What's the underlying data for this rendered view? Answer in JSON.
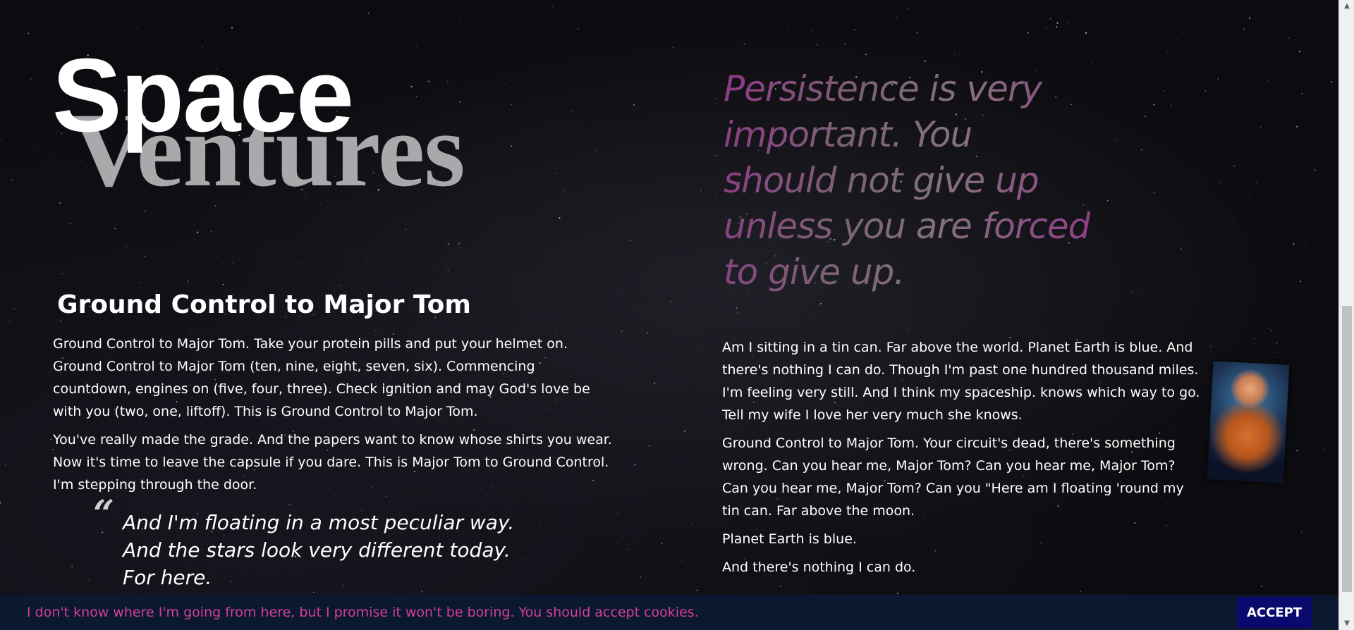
{
  "logo": {
    "word1": "Space",
    "word2": "Ventures"
  },
  "hero_quote": {
    "text": "Persistence is very important. You should not give up unless you are forced to give up."
  },
  "left": {
    "heading": "Ground Control to Major Tom",
    "paragraphs": [
      "Ground Control to Major Tom. Take your protein pills and put your helmet on. Ground Control to Major Tom (ten, nine, eight, seven, six). Commencing countdown, engines on (five, four, three). Check ignition and may God's love be with you (two, one, liftoff). This is Ground Control to Major Tom.",
      "You've really made the grade. And the papers want to know whose shirts you wear. Now it's time to leave the capsule if you dare. This is Major Tom to Ground Control. I'm stepping through the door."
    ],
    "blockquote": {
      "mark": "“",
      "lines": [
        "And I'm floating in a most peculiar way.",
        "And the stars look very different today.",
        "For here."
      ]
    }
  },
  "right": {
    "paragraphs": [
      "Am I sitting in a tin can. Far above the world. Planet Earth is blue. And there's nothing I can do. Though I'm past one hundred thousand miles. I'm feeling very still. And I think my spaceship. knows which way to go. Tell my wife I love her very much she knows.",
      "Ground Control to Major Tom. Your circuit's dead, there's something wrong. Can you hear me, Major Tom? Can you hear me, Major Tom? Can you hear me, Major Tom? Can you \"Here am I floating 'round my tin can. Far above the moon.",
      "Planet Earth is blue.",
      "And there's nothing I can do."
    ]
  },
  "cookie": {
    "message": "I don't know where I'm going from here, but I promise it won't be boring. You should accept cookies.",
    "accept_label": "ACCEPT"
  },
  "icons": {
    "scroll_up": "scroll-up-arrow-icon",
    "scroll_down": "scroll-down-arrow-icon",
    "quote": "quote-mark-icon"
  },
  "colors": {
    "background": "#0c0c10",
    "quote_pink": "#8e3a86",
    "cookie_bar": "#0a1930",
    "cookie_text": "#d63f93",
    "accept_button": "#0a0a6e"
  }
}
